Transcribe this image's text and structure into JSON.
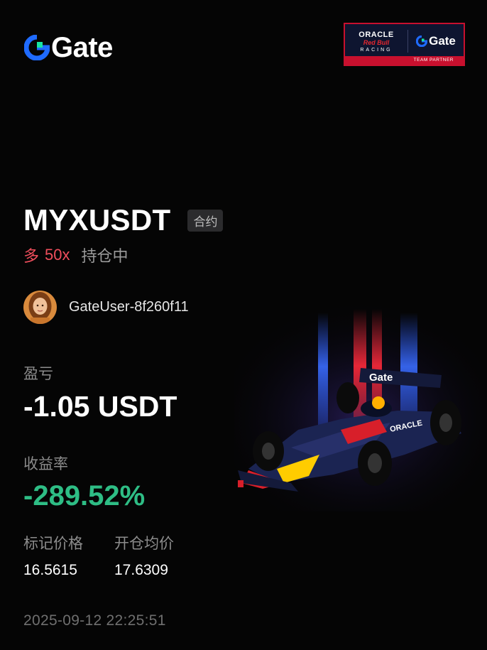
{
  "header": {
    "brand_name": "Gate",
    "partner": {
      "oracle": "ORACLE",
      "redbull": "Red Bull",
      "racing": "RACING",
      "brand": "Gate",
      "strip": "TEAM PARTNER"
    }
  },
  "position": {
    "symbol": "MYXUSDT",
    "type_tag": "合约",
    "side": "多",
    "leverage": "50x",
    "status": "持仓中"
  },
  "user": {
    "name": "GateUser-8f260f11"
  },
  "pnl": {
    "label": "盈亏",
    "value": "-1.05 USDT"
  },
  "roi": {
    "label": "收益率",
    "value": "-289.52%"
  },
  "prices": {
    "mark_label": "标记价格",
    "mark_value": "16.5615",
    "entry_label": "开仓均价",
    "entry_value": "17.6309"
  },
  "timestamp": "2025-09-12 22:25:51",
  "colors": {
    "long": "#ef4e5c",
    "profit_negative_roi": "#2ebd85",
    "brand_blue": "#1f6bff",
    "brand_green": "#17e5a3"
  }
}
